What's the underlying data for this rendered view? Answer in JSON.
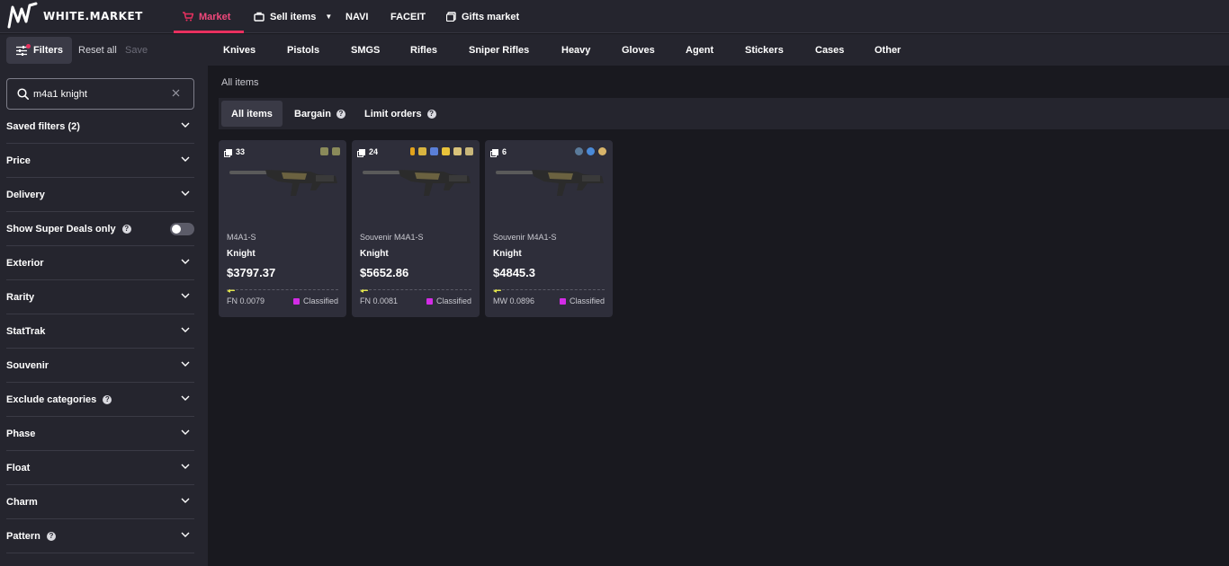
{
  "header": {
    "brand": "WHITE.MARKET",
    "nav": [
      {
        "label": "Market",
        "icon": "cart-icon"
      },
      {
        "label": "Sell items",
        "icon": "bag-icon"
      },
      {
        "label": "NAVI"
      },
      {
        "label": "FACEIT"
      },
      {
        "label": "Gifts market",
        "icon": "gift-icon"
      }
    ],
    "accent_color": "#e8305f"
  },
  "sidebar": {
    "filters_label": "Filters",
    "reset_label": "Reset all",
    "save_label": "Save",
    "search": {
      "value": "m4a1 knight",
      "placeholder": "Search"
    },
    "filters": [
      {
        "label": "Saved filters (2)"
      },
      {
        "label": "Price"
      },
      {
        "label": "Delivery"
      },
      {
        "label": "Show Super Deals only",
        "toggle": false
      },
      {
        "label": "Exterior"
      },
      {
        "label": "Rarity"
      },
      {
        "label": "StatTrak"
      },
      {
        "label": "Souvenir"
      },
      {
        "label": "Exclude categories"
      },
      {
        "label": "Phase"
      },
      {
        "label": "Float"
      },
      {
        "label": "Charm"
      },
      {
        "label": "Pattern"
      }
    ]
  },
  "categories": [
    "Knives",
    "Pistols",
    "SMGS",
    "Rifles",
    "Sniper Rifles",
    "Heavy",
    "Gloves",
    "Agent",
    "Stickers",
    "Cases",
    "Other"
  ],
  "main": {
    "breadcrumb": "All items",
    "tabs": [
      {
        "label": "All items",
        "active": true
      },
      {
        "label": "Bargain",
        "active": false
      },
      {
        "label": "Limit orders",
        "active": false
      }
    ],
    "items": [
      {
        "count": "33",
        "model": "M4A1-S",
        "skin": "Knight",
        "price": "$3797.37",
        "wear": "FN 0.0079",
        "float": 0.0079,
        "rarity": "Classified",
        "rarity_color": "#d32ce6",
        "stickers": [
          "#8a8a5a",
          "#8a8a5a"
        ]
      },
      {
        "count": "24",
        "model": "Souvenir M4A1-S",
        "skin": "Knight",
        "price": "$5652.86",
        "wear": "FN 0.0081",
        "float": 0.0081,
        "rarity": "Classified",
        "rarity_color": "#d32ce6",
        "stickers": [
          "#e2a21c",
          "#d8b440",
          "#5a7fd8",
          "#e8c23a",
          "#d8c27a",
          "#c8b67a"
        ]
      },
      {
        "count": "6",
        "model": "Souvenir M4A1-S",
        "skin": "Knight",
        "price": "$4845.3",
        "wear": "MW 0.0896",
        "float": 0.0896,
        "rarity": "Classified",
        "rarity_color": "#d32ce6",
        "stickers": [
          "#5a7a9a",
          "#4a8ad8",
          "#d8b46a"
        ]
      }
    ]
  }
}
